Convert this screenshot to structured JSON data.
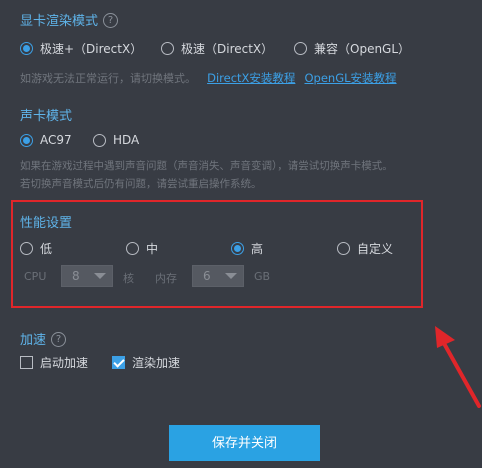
{
  "gpu_mode": {
    "title": "显卡渲染模式",
    "options": [
      "极速+（DirectX）",
      "极速（DirectX）",
      "兼容（OpenGL）"
    ],
    "selected_index": 0,
    "hint": "如游戏无法正常运行，请切换模式。",
    "links": [
      "DirectX安装教程",
      "OpenGL安装教程"
    ]
  },
  "sound_mode": {
    "title": "声卡模式",
    "options": [
      "AC97",
      "HDA"
    ],
    "selected_index": 0,
    "hint_line1": "如果在游戏过程中遇到声音问题（声音消失、声音变调），请尝试切换声卡模式。",
    "hint_line2": "若切换声音模式后仍有问题，请尝试重启操作系统。"
  },
  "performance": {
    "title": "性能设置",
    "options": [
      "低",
      "中",
      "高",
      "自定义"
    ],
    "selected_index": 2,
    "cpu_label": "CPU",
    "cpu_value": "8",
    "cpu_unit": "核",
    "mem_label": "内存",
    "mem_value": "6",
    "mem_unit": "GB"
  },
  "acceleration": {
    "title": "加速",
    "options": [
      {
        "label": "启动加速",
        "checked": false
      },
      {
        "label": "渲染加速",
        "checked": true
      }
    ]
  },
  "footer": {
    "save_label": "保存并关闭"
  },
  "colors": {
    "background": "#383c44",
    "accent": "#2aa2e3",
    "section_title": "#5fb4ea",
    "highlight_box": "#e0262a",
    "annotation_arrow": "#e0262a"
  }
}
